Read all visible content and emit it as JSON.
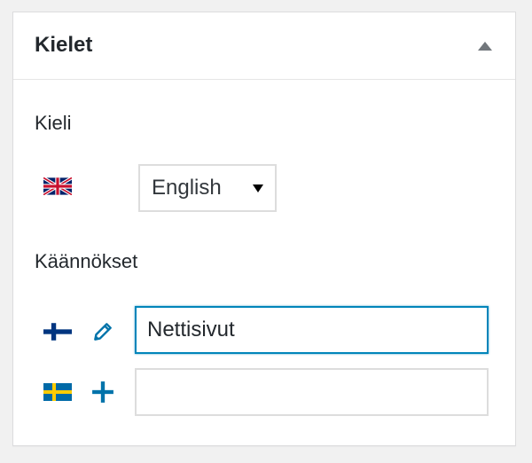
{
  "panel": {
    "title": "Kielet"
  },
  "language": {
    "label": "Kieli",
    "flag_icon": "flag-uk-icon",
    "selected": "English"
  },
  "translations": {
    "label": "Käännökset",
    "items": [
      {
        "flag_icon": "flag-finland-icon",
        "action_icon": "pencil-icon",
        "value": "Nettisivut",
        "placeholder": ""
      },
      {
        "flag_icon": "flag-sweden-icon",
        "action_icon": "plus-icon",
        "value": "",
        "placeholder": ""
      }
    ]
  },
  "colors": {
    "accent": "#0073aa",
    "focus_border": "#0085ba",
    "panel_bg": "#ffffff",
    "page_bg": "#f1f1f1"
  }
}
